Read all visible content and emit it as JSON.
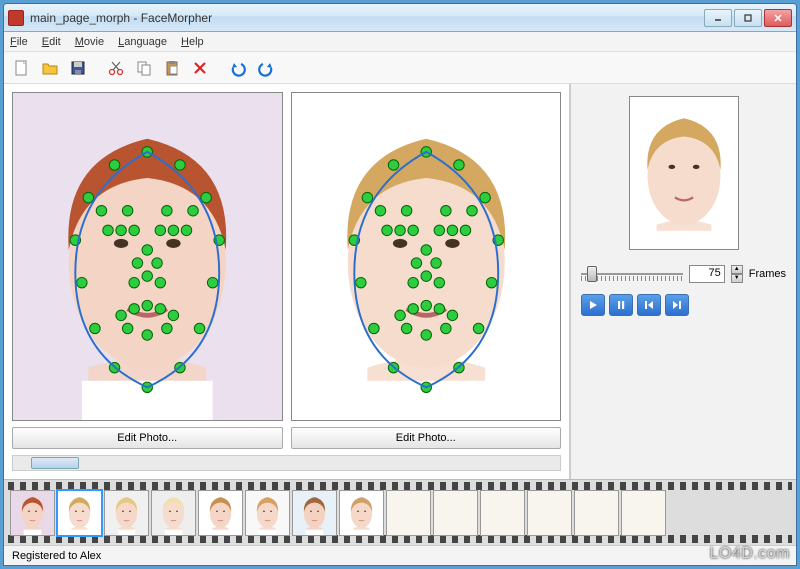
{
  "window": {
    "title": "main_page_morph - FaceMorpher"
  },
  "menu": {
    "file": "File",
    "edit": "Edit",
    "movie": "Movie",
    "language": "Language",
    "help": "Help"
  },
  "toolbar": {
    "new": "new",
    "open": "open",
    "save": "save",
    "cut": "cut",
    "copy": "copy",
    "paste": "paste",
    "delete": "delete",
    "undo": "undo",
    "redo": "redo"
  },
  "edit_photo_label": "Edit Photo...",
  "frames": {
    "value": "75",
    "label": "Frames"
  },
  "playback": {
    "play": "play",
    "pause": "pause",
    "prev": "prev",
    "next": "next"
  },
  "status": "Registered to Alex",
  "watermark": "LO4D.com",
  "filmstrip": {
    "frames": [
      {
        "hair": "#b85530",
        "skin": "#f4d4c4",
        "bg": "#e8d8e8"
      },
      {
        "hair": "#d4a860",
        "skin": "#f6dccc",
        "bg": "#ffffff",
        "selected": true
      },
      {
        "hair": "#e6c884",
        "skin": "#f5d8c8",
        "bg": "#f0f0f0"
      },
      {
        "hair": "#f0e0b0",
        "skin": "#f6dccc",
        "bg": "#eeeeee"
      },
      {
        "hair": "#c89050",
        "skin": "#f5d6c6",
        "bg": "#ffffff"
      },
      {
        "hair": "#d8a060",
        "skin": "#f5d8c8",
        "bg": "#f8f8f8"
      },
      {
        "hair": "#a06840",
        "skin": "#f3d2c2",
        "bg": "#e8f0f8"
      },
      {
        "hair": "#d0a068",
        "skin": "#f5d8c8",
        "bg": "#ffffff"
      }
    ],
    "empty_frames": 6
  },
  "photos": {
    "left": {
      "hair": "#b85530",
      "skin": "#f4d4c4",
      "bg": "#eae0ee"
    },
    "right": {
      "hair": "#d4a860",
      "skin": "#f6dccc",
      "bg": "#ffffff"
    },
    "preview": {
      "hair": "#d4a860",
      "skin": "#f6dccc",
      "bg": "#ffffff"
    }
  },
  "landmarks": [
    [
      50,
      18
    ],
    [
      40,
      22
    ],
    [
      60,
      22
    ],
    [
      32,
      32
    ],
    [
      68,
      32
    ],
    [
      28,
      45
    ],
    [
      72,
      45
    ],
    [
      38,
      42
    ],
    [
      42,
      42
    ],
    [
      46,
      42
    ],
    [
      54,
      42
    ],
    [
      58,
      42
    ],
    [
      62,
      42
    ],
    [
      36,
      36
    ],
    [
      44,
      36
    ],
    [
      56,
      36
    ],
    [
      64,
      36
    ],
    [
      47,
      52
    ],
    [
      50,
      48
    ],
    [
      53,
      52
    ],
    [
      50,
      56
    ],
    [
      46,
      58
    ],
    [
      54,
      58
    ],
    [
      42,
      68
    ],
    [
      46,
      66
    ],
    [
      50,
      65
    ],
    [
      54,
      66
    ],
    [
      58,
      68
    ],
    [
      44,
      72
    ],
    [
      50,
      74
    ],
    [
      56,
      72
    ],
    [
      30,
      58
    ],
    [
      70,
      58
    ],
    [
      34,
      72
    ],
    [
      66,
      72
    ],
    [
      40,
      84
    ],
    [
      60,
      84
    ],
    [
      50,
      90
    ]
  ]
}
